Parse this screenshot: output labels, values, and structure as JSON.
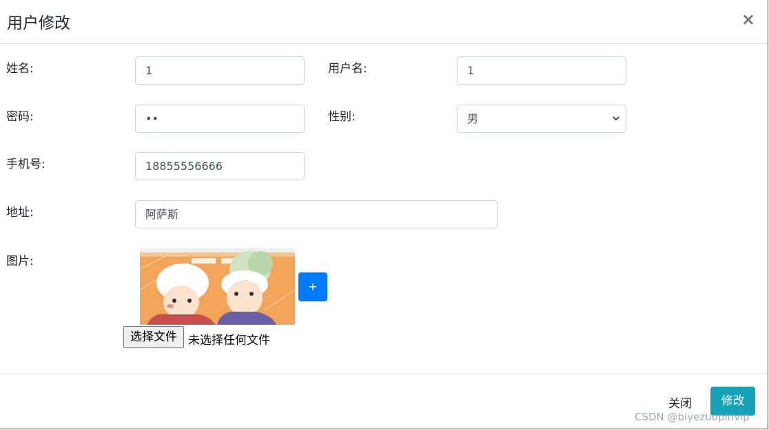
{
  "modal": {
    "title": "用户修改",
    "close_symbol": "×"
  },
  "form": {
    "name_label": "姓名:",
    "name_value": "1",
    "username_label": "用户名:",
    "username_value": "1",
    "password_label": "密码:",
    "password_value": "••",
    "gender_label": "性别:",
    "gender_value": "男",
    "phone_label": "手机号:",
    "phone_value": "18855556666",
    "address_label": "地址:",
    "address_value": "阿萨斯",
    "image_label": "图片:",
    "add_button": "+",
    "file_button": "选择文件",
    "file_status": "未选择任何文件"
  },
  "footer": {
    "close_label": "关闭",
    "submit_label": "修改"
  },
  "watermark": "CSDN @biyezuopinvip",
  "icons": {
    "close": "close-icon",
    "dropdown": "chevron-down-icon"
  }
}
